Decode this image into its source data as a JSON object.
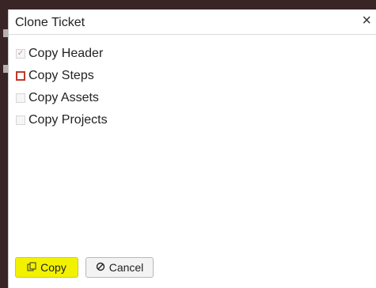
{
  "dialog": {
    "title": "Clone Ticket",
    "close_glyph": "×"
  },
  "options": [
    {
      "label": "Copy Header",
      "checked": true,
      "enabled": false,
      "focused": false
    },
    {
      "label": "Copy Steps",
      "checked": false,
      "enabled": true,
      "focused": true
    },
    {
      "label": "Copy Assets",
      "checked": false,
      "enabled": false,
      "focused": false
    },
    {
      "label": "Copy Projects",
      "checked": false,
      "enabled": false,
      "focused": false
    }
  ],
  "buttons": {
    "copy_label": "Copy",
    "copy_icon": "copy-icon",
    "cancel_label": "Cancel",
    "cancel_icon": "cancel-icon"
  },
  "colors": {
    "highlight": "#f2f200",
    "focus_border": "#c0392b",
    "check_mark": "#d98a9a",
    "backdrop": "#3a2526"
  }
}
